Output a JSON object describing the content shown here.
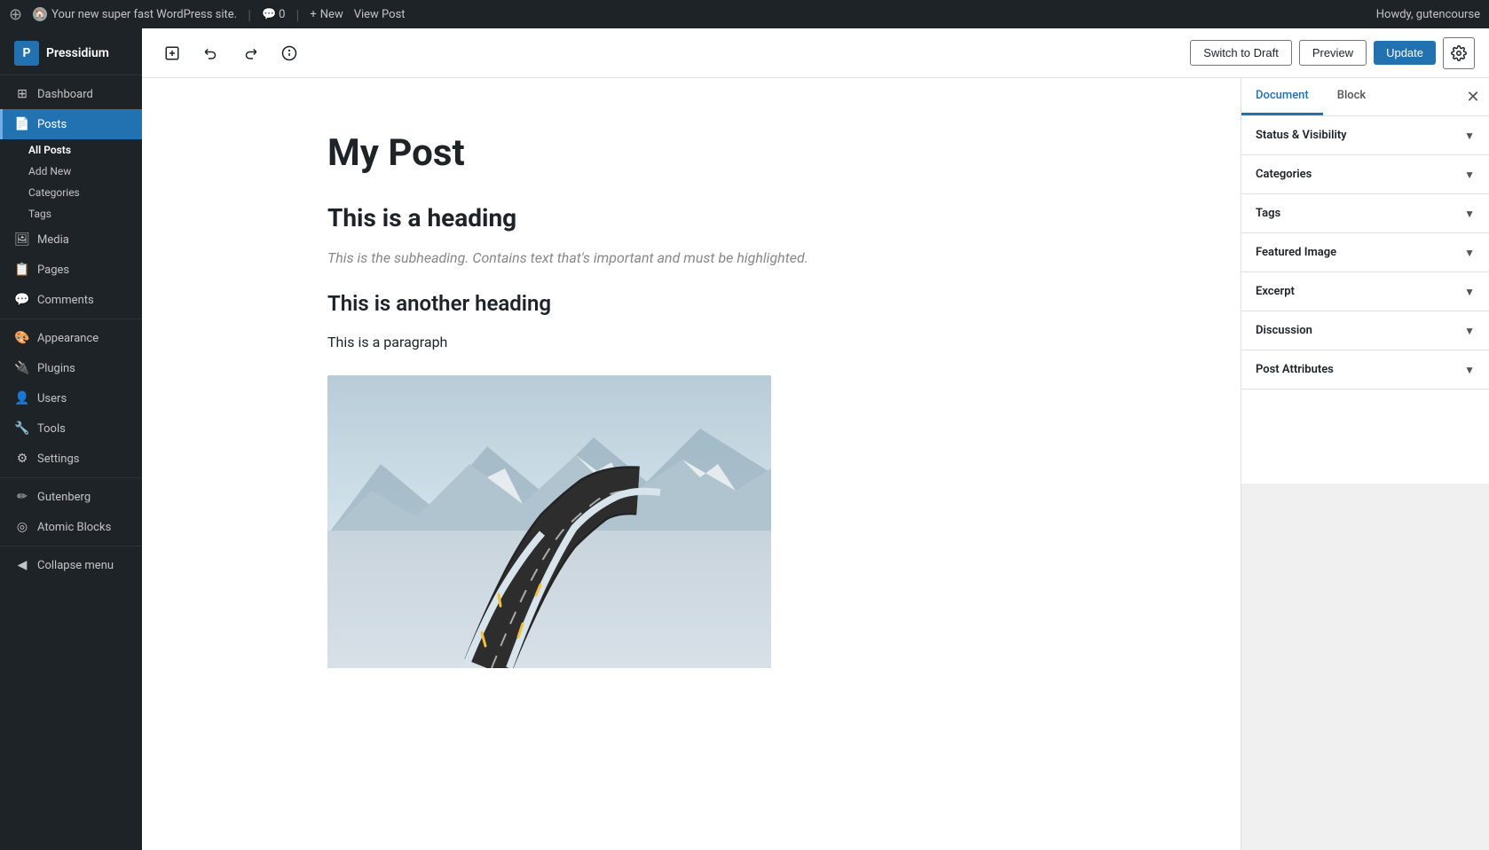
{
  "adminBar": {
    "wpLogoLabel": "WordPress",
    "siteName": "Your new super fast WordPress site.",
    "commentsBubble": "0",
    "newLabel": "New",
    "viewPostLabel": "View Post",
    "howdyLabel": "Howdy, gutencourse"
  },
  "sidebar": {
    "brandName": "Pressidium",
    "items": [
      {
        "id": "dashboard",
        "label": "Dashboard",
        "icon": "⊞"
      },
      {
        "id": "posts",
        "label": "Posts",
        "icon": "📄",
        "active": true
      },
      {
        "id": "media",
        "label": "Media",
        "icon": "🖼"
      },
      {
        "id": "pages",
        "label": "Pages",
        "icon": "📋"
      },
      {
        "id": "comments",
        "label": "Comments",
        "icon": "💬"
      },
      {
        "id": "appearance",
        "label": "Appearance",
        "icon": "🎨"
      },
      {
        "id": "plugins",
        "label": "Plugins",
        "icon": "🔌"
      },
      {
        "id": "users",
        "label": "Users",
        "icon": "👤"
      },
      {
        "id": "tools",
        "label": "Tools",
        "icon": "🔧"
      },
      {
        "id": "settings",
        "label": "Settings",
        "icon": "⚙"
      },
      {
        "id": "gutenberg",
        "label": "Gutenberg",
        "icon": "✏"
      },
      {
        "id": "atomic-blocks",
        "label": "Atomic Blocks",
        "icon": "◎"
      }
    ],
    "postsSubItems": [
      {
        "id": "all-posts",
        "label": "All Posts",
        "active": true
      },
      {
        "id": "add-new",
        "label": "Add New"
      },
      {
        "id": "categories",
        "label": "Categories"
      },
      {
        "id": "tags",
        "label": "Tags"
      }
    ],
    "collapseLabel": "Collapse menu"
  },
  "toolbar": {
    "addBlockTitle": "Add block",
    "undoTitle": "Undo",
    "redoTitle": "Redo",
    "infoTitle": "Information",
    "switchToDraftLabel": "Switch to Draft",
    "previewLabel": "Preview",
    "updateLabel": "Update",
    "settingsTitle": "Settings"
  },
  "post": {
    "title": "My Post",
    "heading1": "This is a heading",
    "subheading": "This is the subheading. Contains text that's important and must be highlighted.",
    "heading2": "This is another heading",
    "paragraph": "This is a paragraph",
    "imageAlt": "Snowy road landscape"
  },
  "settingsPanel": {
    "documentTabLabel": "Document",
    "blockTabLabel": "Block",
    "sections": [
      {
        "id": "status-visibility",
        "label": "Status & Visibility"
      },
      {
        "id": "categories",
        "label": "Categories"
      },
      {
        "id": "tags",
        "label": "Tags"
      },
      {
        "id": "featured-image",
        "label": "Featured Image"
      },
      {
        "id": "excerpt",
        "label": "Excerpt"
      },
      {
        "id": "discussion",
        "label": "Discussion"
      },
      {
        "id": "post-attributes",
        "label": "Post Attributes"
      }
    ]
  }
}
